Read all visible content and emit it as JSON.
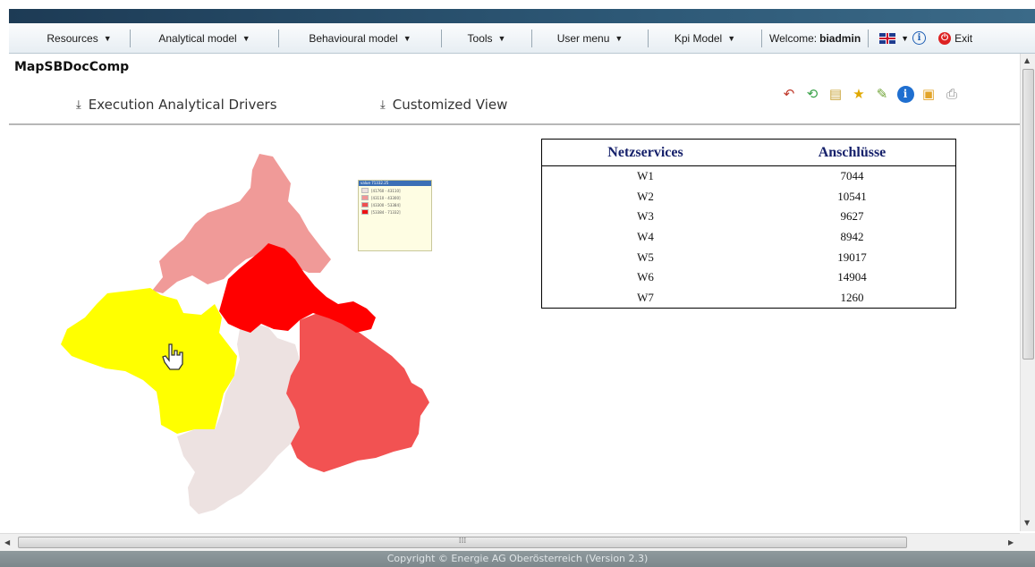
{
  "menubar": {
    "items": [
      {
        "label": "Resources"
      },
      {
        "label": "Analytical model"
      },
      {
        "label": "Behavioural model"
      },
      {
        "label": "Tools"
      },
      {
        "label": "User menu"
      },
      {
        "label": "Kpi Model"
      }
    ],
    "welcome_prefix": "Welcome:",
    "username": "biadmin",
    "exit_label": "Exit"
  },
  "document": {
    "title": "MapSBDocComp",
    "tabs": [
      {
        "label": "Execution Analytical Drivers"
      },
      {
        "label": "Customized View"
      }
    ],
    "toolbar_icons": [
      "back-icon",
      "refresh-icon",
      "add-bookmark-icon",
      "favorite-star-icon",
      "notes-icon",
      "info-icon",
      "send-icon",
      "print-icon"
    ]
  },
  "map": {
    "legend_title": "value 71332.25",
    "legend_items": [
      {
        "label": "[41760 - 43110]",
        "color": "#ece0df"
      },
      {
        "label": "[43110 - 43300]",
        "color": "#f29595"
      },
      {
        "label": "[43300 - 53384]",
        "color": "#ef4f4f"
      },
      {
        "label": "[53384 - 71332]",
        "color": "#ee1111"
      }
    ],
    "colors": {
      "lightest": "#ede2e1",
      "light": "#f09a98",
      "medium": "#f25252",
      "dark": "#ff0000",
      "selected": "#ffff00"
    }
  },
  "table": {
    "headers": [
      "Netzservices",
      "Anschlüsse"
    ],
    "rows": [
      [
        "W1",
        "7044"
      ],
      [
        "W2",
        "10541"
      ],
      [
        "W3",
        "9627"
      ],
      [
        "W4",
        "8942"
      ],
      [
        "W5",
        "19017"
      ],
      [
        "W6",
        "14904"
      ],
      [
        "W7",
        "1260"
      ]
    ]
  },
  "footer": {
    "text": "Copyright © Energie AG Oberösterreich (Version 2.3)"
  }
}
